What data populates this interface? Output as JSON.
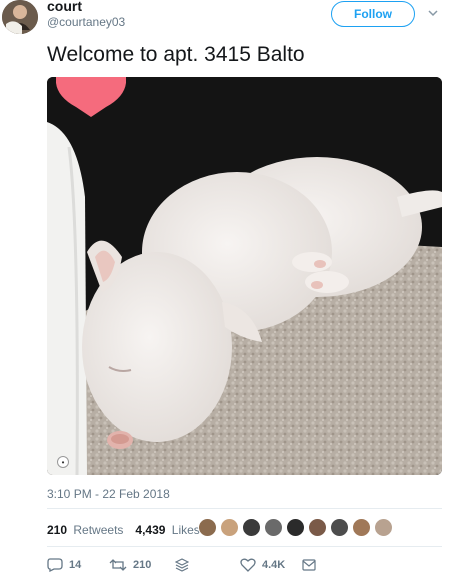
{
  "user": {
    "name": "court",
    "handle": "@courtaney03",
    "follow_label": "Follow"
  },
  "tweet": {
    "text": "Welcome to apt. 3415 Balto",
    "timestamp": "3:10 PM - 22 Feb 2018"
  },
  "stats": {
    "retweets_count": "210",
    "retweets_label": "Retweets",
    "likes_count": "4,439",
    "likes_label": "Likes",
    "liker_avatar_colors": [
      "#8b6b4e",
      "#c9a27c",
      "#3a3a3a",
      "#6a6a6a",
      "#2b2b2b",
      "#7a5a48",
      "#4d4d4d",
      "#a07858",
      "#b8a290"
    ]
  },
  "actions": {
    "reply_count": "14",
    "retweet_count": "210",
    "like_count": "4.4K"
  },
  "colors": {
    "accent": "#1da1f2",
    "muted": "#657786",
    "text": "#14171a",
    "heart_overlay": "#f56b7d"
  },
  "icons": [
    "chevron-down-icon",
    "reply-icon",
    "retweet-icon",
    "stack-icon",
    "heart-icon",
    "message-icon"
  ]
}
